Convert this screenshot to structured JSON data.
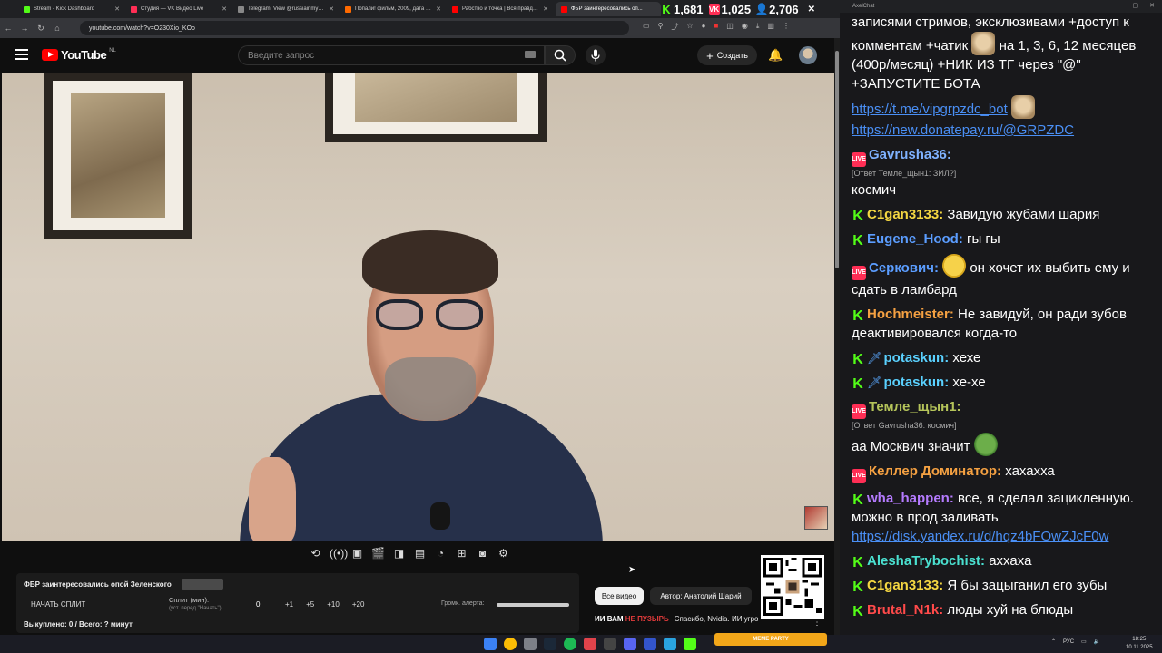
{
  "browser": {
    "tabs": [
      {
        "label": "Stream - Kick Dashboard",
        "color": "#53fc18"
      },
      {
        "label": "Студия — VK Видео Live",
        "color": "#ff2e55"
      },
      {
        "label": "Telegram: View @russiainmyme...",
        "color": "#888888"
      },
      {
        "label": "Попали! фильм, 2009, дата вых...",
        "color": "#ff6a00"
      },
      {
        "label": "Рабство и точка | Вся правда о...",
        "color": "#ff0000"
      },
      {
        "label": "ФБР заинтересовались оп...",
        "color": "#ff0000"
      }
    ],
    "url": "youtube.com/watch?v=O230Xio_KOo"
  },
  "stats": {
    "kick": "1,681",
    "vk": "1,025",
    "viewers": "2,706"
  },
  "youtube": {
    "logo": "YouTube",
    "region": "NL",
    "search_placeholder": "Введите запрос",
    "create_label": "Создать"
  },
  "split": {
    "title": "ФБР заинтересовались опой Зеленского",
    "tag": "",
    "start_label": "НАЧАТЬ СПЛИТ",
    "split_label": "Сплит (мин):",
    "split_hint": "(уст. перед \"Начать\")",
    "zero": "0",
    "increments": [
      "+1",
      "+5",
      "+10",
      "+20"
    ],
    "volume_label": "Громк. алерта:",
    "done": "Выкуплено: 0 / Всего: ? минут"
  },
  "chips": {
    "all": "Все видео",
    "author": "Автор: Анатолий Шарий"
  },
  "rec": {
    "thumb_a": "ИИ ВАМ ",
    "thumb_b": "НЕ ПУЗЫРЬ",
    "title": "Спасибо, Nvidia. ИИ угробит"
  },
  "chat": {
    "window_title": "AxelChat",
    "intro1": "записями стримов, эксклюзивами +доступ к комментам +чатик",
    "intro2": "на 1, 3, 6, 12 месяцев (400р/месяц) +НИК ИЗ ТГ через \"@\" +ЗАПУСТИТЕ БОТА",
    "link1": "https://t.me/vipgrpzdc_bot",
    "link2": "https://new.donatepay.ru/@GRPZDC",
    "messages": [
      {
        "platform": "vk",
        "nick": "Gavrusha36:",
        "color": "#7fb2ff",
        "reply": "[Ответ Темле_щын1: ЗИЛ?]",
        "text": "космич"
      },
      {
        "platform": "kick",
        "nick": "C1gan3133:",
        "color": "#f5d742",
        "text": "Завидую жубами шария"
      },
      {
        "platform": "kick",
        "nick": "Eugene_Hood:",
        "color": "#5b9dff",
        "text": "гы гы"
      },
      {
        "platform": "vk",
        "nick": "Серкович:",
        "color": "#5b9dff",
        "text": "он хочет их выбить ему и сдать в ламбард",
        "emote": "smile"
      },
      {
        "platform": "kick",
        "nick": "Hochmeister:",
        "color": "#f5a142",
        "text": "Не завидуй, он ради зубов деактивировался когда-то"
      },
      {
        "platform": "kick",
        "nick": "potaskun:",
        "color": "#5ad1ff",
        "text": "хехе",
        "sword": true
      },
      {
        "platform": "kick",
        "nick": "potaskun:",
        "color": "#5ad1ff",
        "text": "хе-хе",
        "sword": true
      },
      {
        "platform": "vk",
        "nick": "Темле_щын1:",
        "color": "#b5c45a",
        "reply": "[Ответ Gavrusha36: космич]",
        "text": "аа Москвич значит",
        "emote": "frog"
      },
      {
        "platform": "vk",
        "nick": "Келлер Доминатор:",
        "color": "#f5a142",
        "text": "хахахха"
      },
      {
        "platform": "kick",
        "nick": "wha_happen:",
        "color": "#b57bff",
        "text": "все, я сделал зацикленную. можно в прод заливать",
        "link": "https://disk.yandex.ru/d/hqz4bFOwZJcF0w"
      },
      {
        "platform": "kick",
        "nick": "AleshaTrybochist:",
        "color": "#4ae0d0",
        "text": "аххаха"
      },
      {
        "platform": "kick",
        "nick": "C1gan3133:",
        "color": "#f5d742",
        "text": "Я бы зацыганил его зубы"
      },
      {
        "platform": "kick",
        "nick": "Brutal_N1k:",
        "color": "#ff4a4a",
        "text": "люды хуй на блюды"
      }
    ]
  },
  "taskbar": {
    "meme": "MEME PARTY",
    "lang": "РУС",
    "time": "18:25",
    "date": "10.11.2025"
  }
}
